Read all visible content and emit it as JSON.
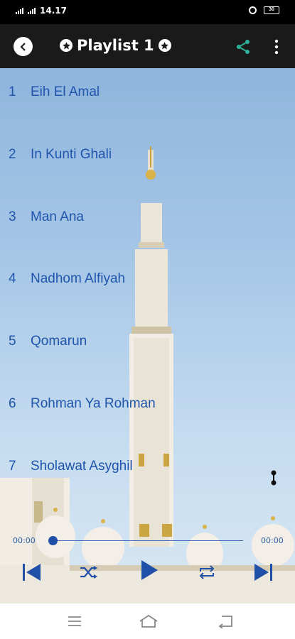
{
  "status_bar": {
    "time": "14.17",
    "battery": "30"
  },
  "app_bar": {
    "title": "Playlist 1",
    "icons": [
      "back-icon",
      "star-icon",
      "share-icon",
      "more-vert-icon"
    ]
  },
  "playlist": [
    {
      "number": "1",
      "title": "Eih El Amal"
    },
    {
      "number": "2",
      "title": "In Kunti Ghali"
    },
    {
      "number": "3",
      "title": "Man Ana"
    },
    {
      "number": "4",
      "title": "Nadhom Alfiyah"
    },
    {
      "number": "5",
      "title": "Qomarun"
    },
    {
      "number": "6",
      "title": "Rohman Ya Rohman"
    },
    {
      "number": "7",
      "title": "Sholawat Asyghil"
    }
  ],
  "player": {
    "current_time": "00:00",
    "total_time": "00:00",
    "progress": 0,
    "controls": [
      "skip-previous-icon",
      "shuffle-icon",
      "play-icon",
      "repeat-icon",
      "skip-next-icon"
    ]
  },
  "colors": {
    "accent_blue": "#1f55ad",
    "share_green": "#2fb39a",
    "app_bar_bg": "#1a1a1a"
  },
  "nav_bar": {
    "icons": [
      "recent-apps-icon",
      "home-icon",
      "back-nav-icon"
    ]
  }
}
